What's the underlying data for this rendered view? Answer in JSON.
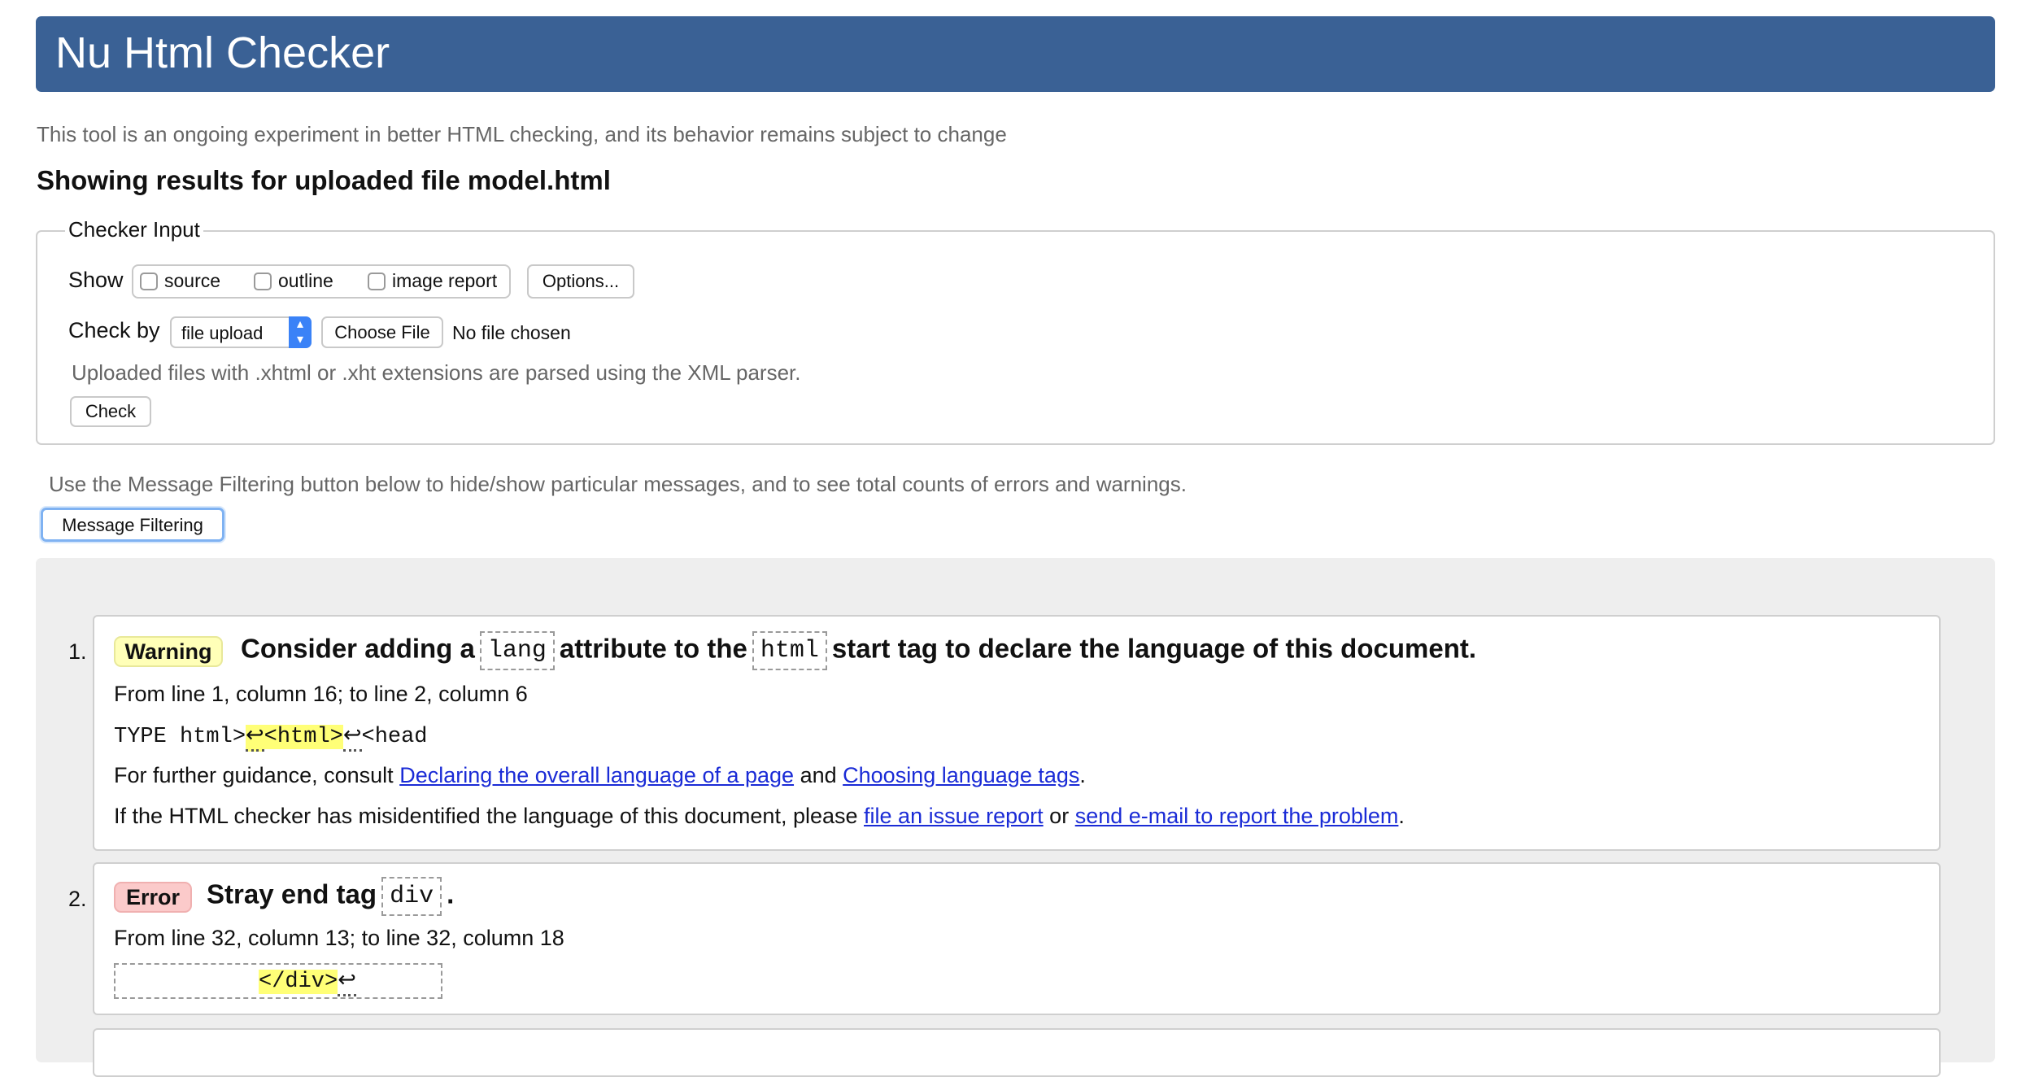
{
  "header": {
    "title": "Nu Html Checker"
  },
  "tagline": "This tool is an ongoing experiment in better HTML checking, and its behavior remains subject to change",
  "showing": "Showing results for uploaded file model.html",
  "checker_input": {
    "legend": "Checker Input",
    "show_label": "Show",
    "show_options": [
      "source",
      "outline",
      "image report"
    ],
    "options_button": "Options...",
    "check_by_label": "Check by",
    "check_by_selected": "file upload",
    "choose_file_button": "Choose File",
    "no_file_text": "No file chosen",
    "parser_note": "Uploaded files with .xhtml or .xht extensions are parsed using the XML parser.",
    "check_button": "Check"
  },
  "filter": {
    "hint": "Use the Message Filtering button below to hide/show particular messages, and to see total counts of errors and warnings.",
    "button": "Message Filtering"
  },
  "messages": [
    {
      "number": "1.",
      "type": "Warning",
      "title_parts": [
        "Consider adding a",
        "lang",
        "attribute to the",
        "html",
        "start tag to declare the language of this document."
      ],
      "location": "From line 1, column 16; to line 2, column 6",
      "extract": {
        "before": "TYPE html>",
        "ret1": "↩",
        "highlight": "<html>",
        "ret2": "↩",
        "after": "<head"
      },
      "guidance": {
        "prefix": "For further guidance, consult",
        "link1": "Declaring the overall language of a page",
        "mid": "and",
        "link2": "Choosing language tags",
        "suffix": "."
      },
      "misidentified": {
        "prefix": "If the HTML checker has misidentified the language of this document, please",
        "link1": "file an issue report",
        "mid": "or",
        "link2": "send e-mail to report the problem",
        "suffix": "."
      }
    },
    {
      "number": "2.",
      "type": "Error",
      "title_parts": [
        "Stray end tag",
        "div",
        "."
      ],
      "location": "From line 32, column 13; to line 32, column 18",
      "extract": {
        "highlight": "</div>",
        "ret": "↩"
      }
    }
  ]
}
